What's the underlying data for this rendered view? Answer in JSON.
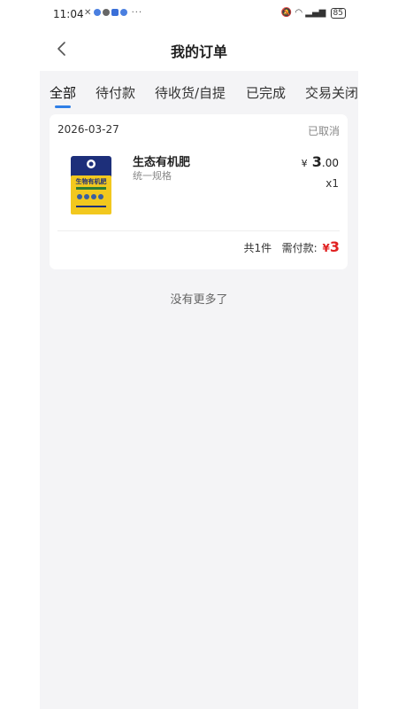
{
  "status_bar": {
    "time": "11:04",
    "left_icons": "✕",
    "more": "···",
    "battery": "85"
  },
  "nav": {
    "title": "我的订单"
  },
  "tabs": [
    {
      "label": "全部",
      "active": true
    },
    {
      "label": "待付款",
      "active": false
    },
    {
      "label": "待收货/自提",
      "active": false
    },
    {
      "label": "已完成",
      "active": false
    },
    {
      "label": "交易关闭",
      "active": false
    }
  ],
  "order": {
    "date": "2026-03-27",
    "status": "已取消",
    "product": {
      "name": "生态有机肥",
      "spec": "统一规格",
      "image_text": "生物有机肥",
      "price_symbol": "¥",
      "price_int": "3",
      "price_dec": ".00",
      "qty": "x1"
    },
    "summary": {
      "count_text": "共1件",
      "pay_label": "需付款:",
      "pay_symbol": "¥",
      "pay_value": "3"
    }
  },
  "footer": {
    "no_more": "没有更多了"
  },
  "colors": {
    "accent": "#2f7fe6",
    "price_red": "#e02020",
    "background": "#f4f4f6"
  }
}
